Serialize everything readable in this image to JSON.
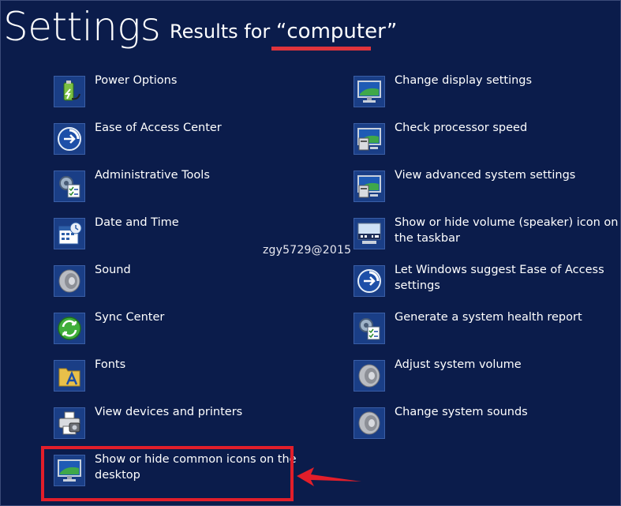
{
  "header": {
    "title": "Settings",
    "results_prefix": "Results for ",
    "query": "“computer”"
  },
  "watermark": "zgy5729@2015",
  "left_items": [
    {
      "label": "Power Options",
      "icon": "power-options-icon"
    },
    {
      "label": "Ease of Access Center",
      "icon": "ease-of-access-icon"
    },
    {
      "label": "Administrative Tools",
      "icon": "admin-tools-icon"
    },
    {
      "label": "Date and Time",
      "icon": "date-time-icon"
    },
    {
      "label": "Sound",
      "icon": "speaker-icon"
    },
    {
      "label": "Sync Center",
      "icon": "sync-center-icon"
    },
    {
      "label": "Fonts",
      "icon": "fonts-folder-icon"
    },
    {
      "label": "View devices and printers",
      "icon": "devices-printers-icon"
    },
    {
      "label": "Show or hide common icons on the desktop",
      "icon": "desktop-monitor-icon"
    }
  ],
  "right_items": [
    {
      "label": "Change display settings",
      "icon": "monitor-icon"
    },
    {
      "label": "Check processor speed",
      "icon": "system-monitor-icon"
    },
    {
      "label": "View advanced system settings",
      "icon": "system-monitor-icon"
    },
    {
      "label": "Show or hide volume (speaker) icon on the taskbar",
      "icon": "taskbar-icon"
    },
    {
      "label": "Let Windows suggest Ease of Access settings",
      "icon": "ease-of-access-icon"
    },
    {
      "label": "Generate a system health report",
      "icon": "admin-tools-icon"
    },
    {
      "label": "Adjust system volume",
      "icon": "speaker-icon"
    },
    {
      "label": "Change system sounds",
      "icon": "speaker-icon"
    }
  ],
  "colors": {
    "background": "#0b1c4b",
    "highlight": "#e21e2a",
    "underline": "#e0343c"
  }
}
